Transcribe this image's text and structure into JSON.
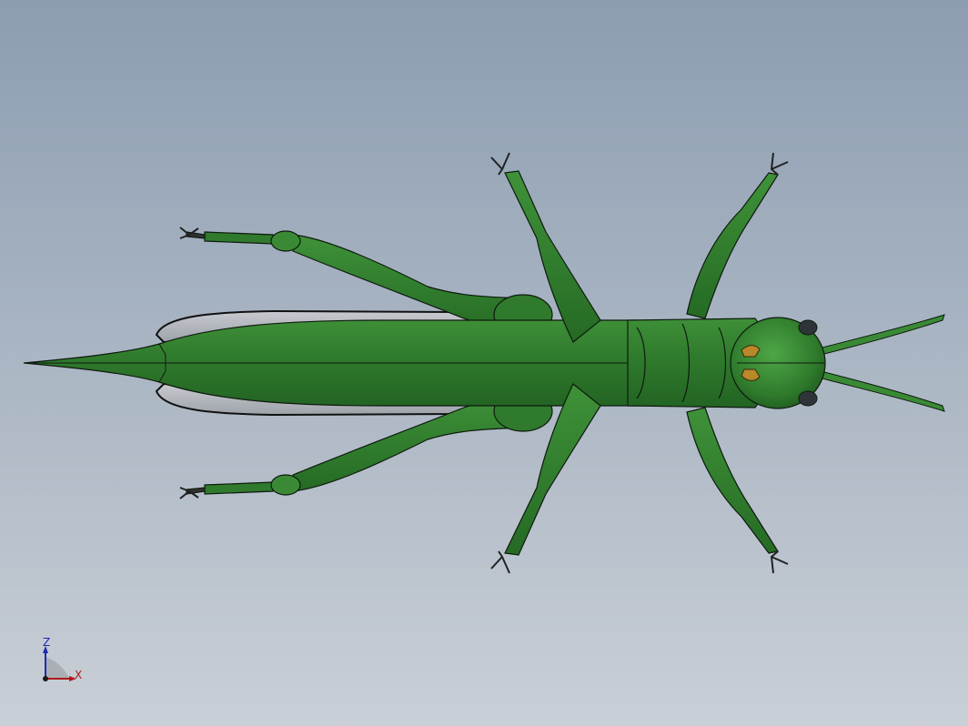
{
  "viewport": {
    "background_top": "#8c9db1",
    "background_bottom": "#c9cfd6"
  },
  "model": {
    "body_color": "#2f7a2c",
    "body_highlight": "#4ea646",
    "body_shadow": "#1c4f1b",
    "outline_color": "#0f1a0f",
    "wing_color": "#b8bcc2",
    "eye_color": "#2e3438",
    "mouth_color": "#b9882a"
  },
  "triad": {
    "z_label": "Z",
    "x_label": "X",
    "z_color": "#1b2bb0",
    "x_color": "#b01b1b"
  }
}
